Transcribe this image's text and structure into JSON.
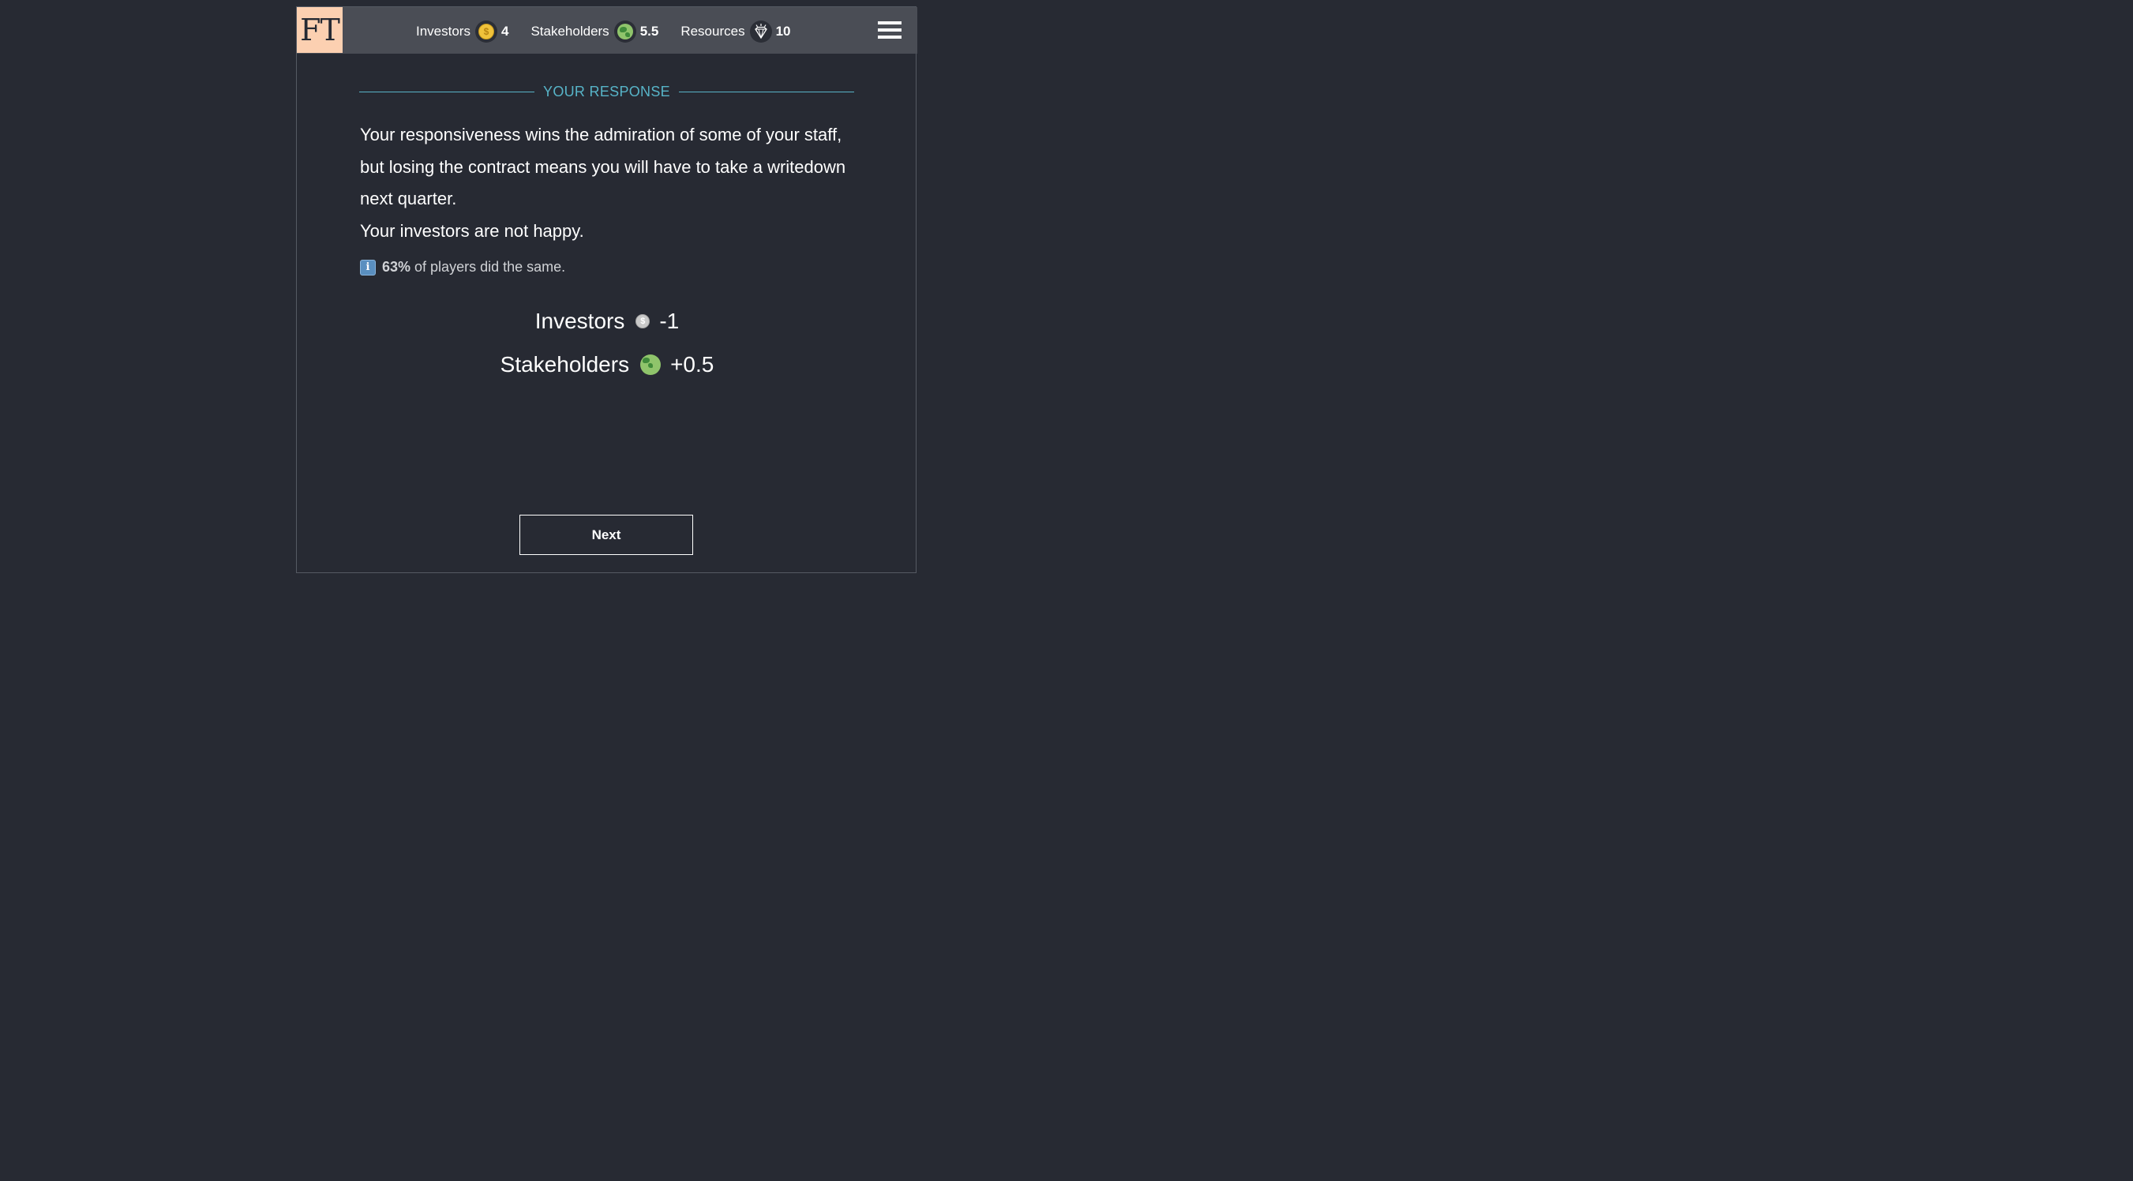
{
  "header": {
    "logo_text": "FT",
    "stats": [
      {
        "label": "Investors",
        "icon": "coin-icon",
        "value": "4"
      },
      {
        "label": "Stakeholders",
        "icon": "globe-icon",
        "value": "5.5"
      },
      {
        "label": "Resources",
        "icon": "diamond-icon",
        "value": "10"
      }
    ],
    "menu_icon": "hamburger-menu-icon"
  },
  "response": {
    "heading": "YOUR RESPONSE",
    "paragraph_1": "Your responsiveness wins the admiration of some of your staff, but losing the contract means you will have to take a writedown next quarter.",
    "paragraph_2": "Your investors are not happy.",
    "poll_percent": "63%",
    "poll_text": "of players did the same."
  },
  "effects": [
    {
      "label": "Investors",
      "icon": "coin-icon",
      "value": "-1"
    },
    {
      "label": "Stakeholders",
      "icon": "globe-icon",
      "value": "+0.5"
    }
  ],
  "next_label": "Next",
  "colors": {
    "background": "#272a33",
    "topbar": "#4a4d55",
    "logo_bg": "#fcd0b1",
    "accent": "#57b4c8",
    "coin": "#f0c23b"
  }
}
